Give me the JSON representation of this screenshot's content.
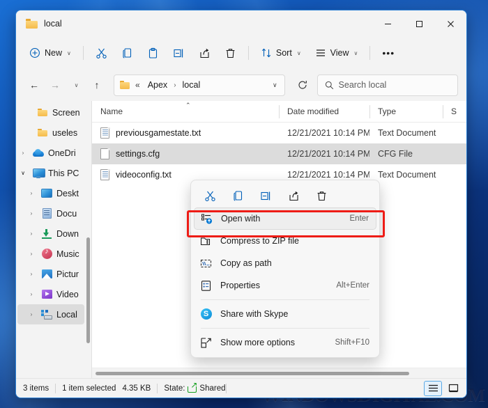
{
  "window": {
    "title": "local",
    "folder_icon": "folder-icon",
    "minimize": "−",
    "maximize": "☐",
    "close": "✕"
  },
  "toolbar": {
    "new_label": "New",
    "new_icon": "plus-circle-icon",
    "cut_icon": "scissors-icon",
    "copy_icon": "copy-icon",
    "paste_icon": "paste-icon",
    "rename_icon": "rename-icon",
    "share_icon": "share-icon",
    "delete_icon": "trash-icon",
    "sort_label": "Sort",
    "sort_icon": "sort-arrows-icon",
    "view_label": "View",
    "view_icon": "lines-icon",
    "more_label": "•••",
    "chevron": "∨"
  },
  "address": {
    "back_icon": "←",
    "forward_icon": "→",
    "recent_icon": "∨",
    "up_icon": "↑",
    "breadcrumb_prefix": "«",
    "crumbs": [
      "Apex",
      "local"
    ],
    "crumb_sep": "›",
    "dropdown_icon": "∨",
    "refresh_icon": "↻",
    "search_placeholder": "Search local",
    "search_icon": "magnifier-icon"
  },
  "sidebar": {
    "items": [
      {
        "label": "Screen",
        "icon": "folder-icon",
        "expander": "",
        "indent": 2,
        "selected": false
      },
      {
        "label": "useles",
        "icon": "folder-icon",
        "expander": "",
        "indent": 2,
        "selected": false
      },
      {
        "label": "OneDri",
        "icon": "cloud-icon",
        "expander": "›",
        "indent": 0,
        "selected": false
      },
      {
        "label": "This PC",
        "icon": "pc-icon",
        "expander": "∨",
        "indent": 0,
        "selected": false
      },
      {
        "label": "Deskt",
        "icon": "desktop-icon",
        "expander": "›",
        "indent": 1,
        "selected": false
      },
      {
        "label": "Docu",
        "icon": "documents-icon",
        "expander": "›",
        "indent": 1,
        "selected": false
      },
      {
        "label": "Down",
        "icon": "downloads-icon",
        "expander": "›",
        "indent": 1,
        "selected": false
      },
      {
        "label": "Music",
        "icon": "music-icon",
        "expander": "›",
        "indent": 1,
        "selected": false
      },
      {
        "label": "Pictur",
        "icon": "pictures-icon",
        "expander": "›",
        "indent": 1,
        "selected": false
      },
      {
        "label": "Video",
        "icon": "videos-icon",
        "expander": "›",
        "indent": 1,
        "selected": false
      },
      {
        "label": "Local",
        "icon": "local-disk-icon",
        "expander": "›",
        "indent": 1,
        "selected": true
      }
    ]
  },
  "filelist": {
    "columns": {
      "name": "Name",
      "date_modified": "Date modified",
      "type": "Type",
      "size": "S"
    },
    "sort_caret": "⌃",
    "rows": [
      {
        "name": "previousgamestate.txt",
        "date": "12/21/2021 10:14 PM",
        "type": "Text Document",
        "icon": "text-file-icon",
        "selected": false
      },
      {
        "name": "settings.cfg",
        "date": "12/21/2021 10:14 PM",
        "type": "CFG File",
        "icon": "generic-file-icon",
        "selected": true
      },
      {
        "name": "videoconfig.txt",
        "date": "12/21/2021 10:14 PM",
        "type": "Text Document",
        "icon": "text-file-icon",
        "selected": false
      }
    ]
  },
  "context_menu": {
    "toolbar_icons": [
      "cut-icon",
      "copy-icon",
      "rename-icon",
      "share-icon",
      "delete-icon"
    ],
    "items": [
      {
        "label": "Open with",
        "accel": "Enter",
        "icon": "open-with-icon",
        "focused": true,
        "separator_after": false
      },
      {
        "label": "Compress to ZIP file",
        "accel": "",
        "icon": "zip-icon",
        "focused": false,
        "separator_after": false
      },
      {
        "label": "Copy as path",
        "accel": "",
        "icon": "copy-path-icon",
        "focused": false,
        "separator_after": false
      },
      {
        "label": "Properties",
        "accel": "Alt+Enter",
        "icon": "properties-icon",
        "focused": false,
        "separator_after": true
      },
      {
        "label": "Share with Skype",
        "accel": "",
        "icon": "skype-icon",
        "focused": false,
        "separator_after": true
      },
      {
        "label": "Show more options",
        "accel": "Shift+F10",
        "icon": "show-more-icon",
        "focused": false,
        "separator_after": false
      }
    ]
  },
  "statusbar": {
    "item_count": "3 items",
    "selection": "1 item selected",
    "selection_size": "4.35 KB",
    "state_label": "State:",
    "state_value": "Shared",
    "state_icon": "shared-icon",
    "details_view_icon": "details-view-icon",
    "large_icons_view_icon": "large-icons-view-icon"
  },
  "watermark": {
    "text_cap_w": "W",
    "text_1": "INDOWS",
    "text_cap_d": "D",
    "text_2": "IGITAL.COM"
  },
  "colors": {
    "accent": "#005fb8",
    "highlight_box": "#ee1c16",
    "selection": "#dcdcdc",
    "window_chrome": "#f3f3f3"
  }
}
